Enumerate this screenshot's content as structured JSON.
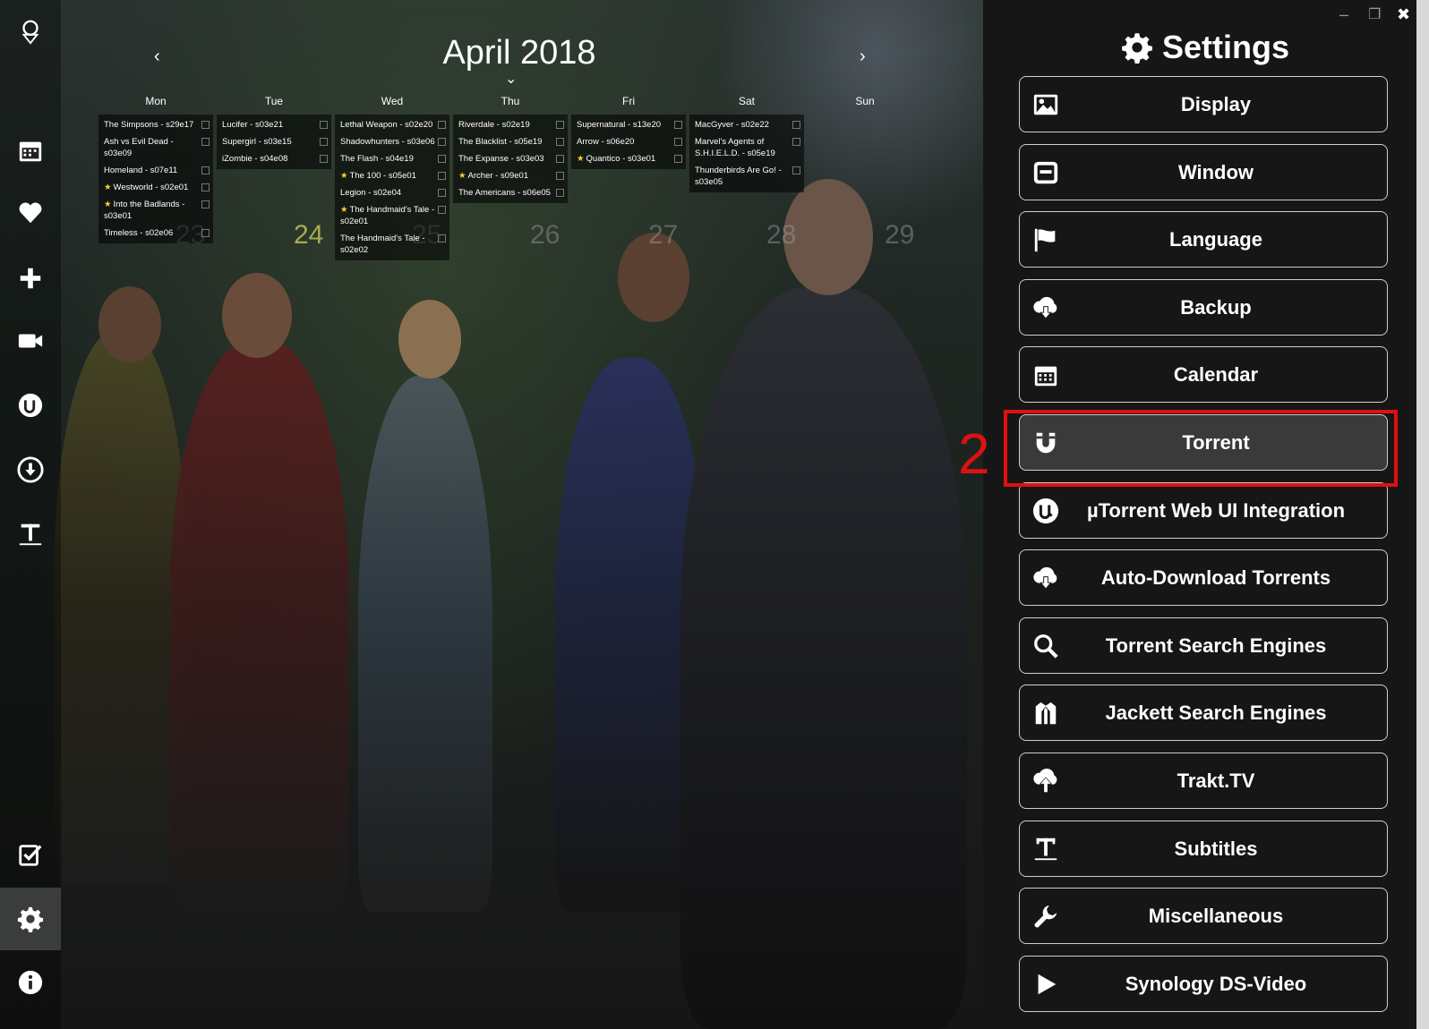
{
  "calendar": {
    "title": "April 2018",
    "prev": "‹",
    "next": "›",
    "dropdown": "⌄",
    "days": [
      {
        "name": "Mon",
        "num": "23",
        "episodes": [
          {
            "t": "The Simpsons - s29e17",
            "star": false
          },
          {
            "t": "Ash vs Evil Dead - s03e09",
            "star": false
          },
          {
            "t": "Homeland - s07e11",
            "star": false
          },
          {
            "t": "Westworld - s02e01",
            "star": true
          },
          {
            "t": "Into the Badlands - s03e01",
            "star": true
          },
          {
            "t": "Timeless - s02e06",
            "star": false
          }
        ]
      },
      {
        "name": "Tue",
        "num": "24",
        "today": true,
        "episodes": [
          {
            "t": "Lucifer - s03e21",
            "star": false
          },
          {
            "t": "Supergirl - s03e15",
            "star": false
          },
          {
            "t": "iZombie - s04e08",
            "star": false
          }
        ]
      },
      {
        "name": "Wed",
        "num": "25",
        "episodes": [
          {
            "t": "Lethal Weapon - s02e20",
            "star": false
          },
          {
            "t": "Shadowhunters - s03e06",
            "star": false
          },
          {
            "t": "The Flash - s04e19",
            "star": false
          },
          {
            "t": "The 100 - s05e01",
            "star": true
          },
          {
            "t": "Legion - s02e04",
            "star": false
          },
          {
            "t": "The Handmaid's Tale - s02e01",
            "star": true
          },
          {
            "t": "The Handmaid's Tale - s02e02",
            "star": false
          }
        ]
      },
      {
        "name": "Thu",
        "num": "26",
        "episodes": [
          {
            "t": "Riverdale - s02e19",
            "star": false
          },
          {
            "t": "The Blacklist - s05e19",
            "star": false
          },
          {
            "t": "The Expanse - s03e03",
            "star": false
          },
          {
            "t": "Archer - s09e01",
            "star": true
          },
          {
            "t": "The Americans - s06e05",
            "star": false
          }
        ]
      },
      {
        "name": "Fri",
        "num": "27",
        "episodes": [
          {
            "t": "Supernatural - s13e20",
            "star": false
          },
          {
            "t": "Arrow - s06e20",
            "star": false
          },
          {
            "t": "Quantico - s03e01",
            "star": true
          }
        ]
      },
      {
        "name": "Sat",
        "num": "28",
        "episodes": [
          {
            "t": "MacGyver - s02e22",
            "star": false
          },
          {
            "t": "Marvel's Agents of S.H.I.E.L.D. - s05e19",
            "star": false
          },
          {
            "t": "Thunderbirds Are Go! - s03e05",
            "star": false
          }
        ]
      },
      {
        "name": "Sun",
        "num": "29",
        "episodes": []
      }
    ]
  },
  "settings": {
    "title": "Settings",
    "items": [
      {
        "label": "Display",
        "icon": "image-icon"
      },
      {
        "label": "Window",
        "icon": "window-icon"
      },
      {
        "label": "Language",
        "icon": "flag-icon"
      },
      {
        "label": "Backup",
        "icon": "cloud-download-icon"
      },
      {
        "label": "Calendar",
        "icon": "calendar-icon"
      },
      {
        "label": "Torrent",
        "icon": "magnet-icon"
      },
      {
        "label": "µTorrent Web UI Integration",
        "icon": "utorrent-icon"
      },
      {
        "label": "Auto-Download Torrents",
        "icon": "cloud-download-icon"
      },
      {
        "label": "Torrent Search Engines",
        "icon": "search-icon"
      },
      {
        "label": "Jackett Search Engines",
        "icon": "jacket-icon"
      },
      {
        "label": "Trakt.TV",
        "icon": "cloud-upload-icon"
      },
      {
        "label": "Subtitles",
        "icon": "text-icon"
      },
      {
        "label": "Miscellaneous",
        "icon": "wrench-icon"
      },
      {
        "label": "Synology DS-Video",
        "icon": "play-icon"
      }
    ]
  },
  "annotation": {
    "step": "2"
  },
  "colors": {
    "highlight": "#e01010",
    "panel": "#161616",
    "today": "#c8c85a",
    "star": "#f2d33a"
  }
}
